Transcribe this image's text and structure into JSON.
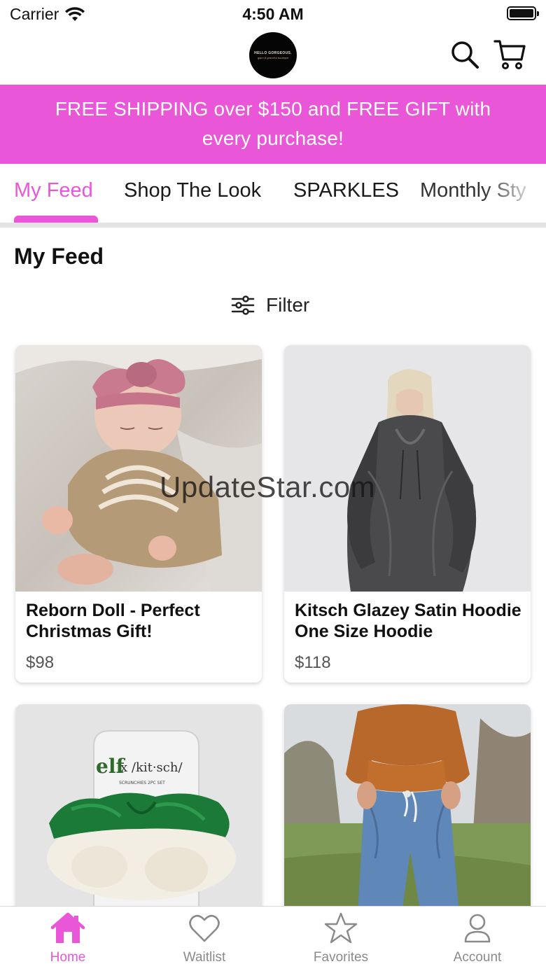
{
  "status_bar": {
    "carrier": "Carrier",
    "time": "4:50 AM"
  },
  "header": {
    "logo_line1": "HELLO GORGEOUS.",
    "logo_line2": "glam & graceful boutique"
  },
  "banner": {
    "text": "FREE SHIPPING over $150 and FREE GIFT with every purchase!"
  },
  "tabs": [
    "My Feed",
    "Shop The Look",
    "SPARKLES",
    "Monthly Sty"
  ],
  "feed": {
    "title": "My Feed",
    "filter_label": "Filter",
    "products": [
      {
        "title": "Reborn Doll - Perfect Christmas Gift!",
        "price": "$98"
      },
      {
        "title": "Kitsch Glazey Satin Hoodie One Size Hoodie",
        "price": "$118"
      },
      {
        "title": "",
        "price": ""
      },
      {
        "title": "",
        "price": ""
      }
    ],
    "package_text": {
      "brand": "elf",
      "partner": "x /kit·sch/",
      "subtitle": "SCRUNCHIES 2PC SET"
    }
  },
  "watermark": "UpdateStar.com",
  "bottom_nav": [
    {
      "label": "Home",
      "icon": "home-icon",
      "active": true
    },
    {
      "label": "Waitlist",
      "icon": "heart-icon",
      "active": false
    },
    {
      "label": "Favorites",
      "icon": "star-icon",
      "active": false
    },
    {
      "label": "Account",
      "icon": "user-icon",
      "active": false
    }
  ],
  "colors": {
    "accent": "#e957d8",
    "inactive": "#8a8a8a",
    "text": "#111111"
  }
}
